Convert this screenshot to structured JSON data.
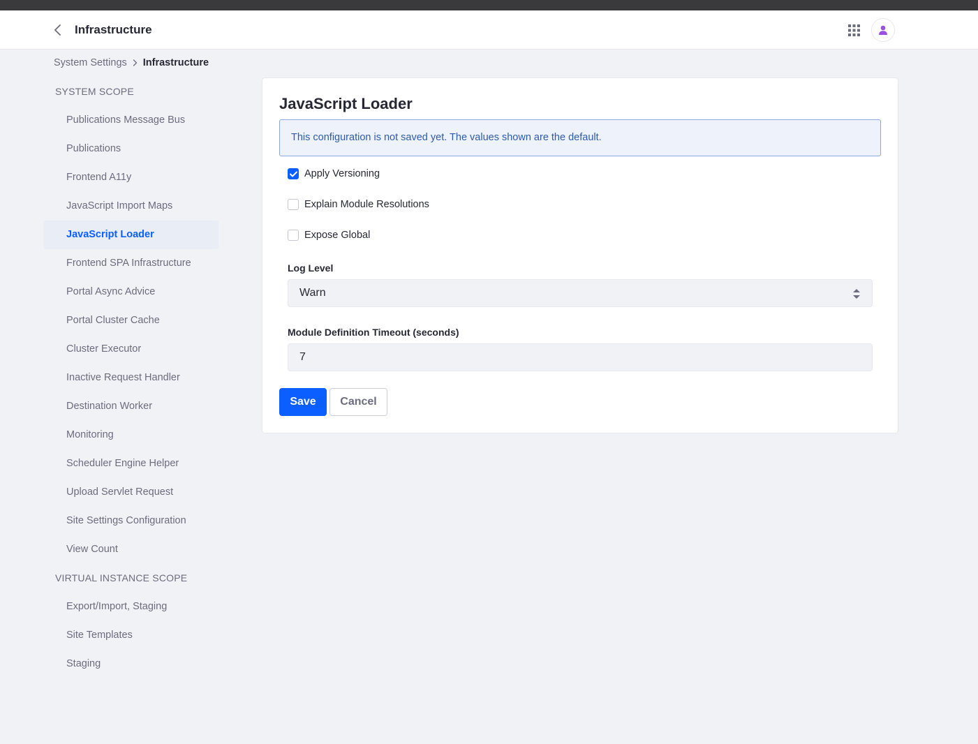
{
  "header": {
    "title": "Infrastructure",
    "back_icon": "chevron-left-icon",
    "apps_icon": "apps-grid-icon",
    "avatar_icon": "user-icon"
  },
  "breadcrumb": {
    "parent": "System Settings",
    "current": "Infrastructure"
  },
  "sidebar": {
    "system_scope_heading": "SYSTEM SCOPE",
    "system_items": [
      {
        "label": "Publications Message Bus"
      },
      {
        "label": "Publications"
      },
      {
        "label": "Frontend A11y"
      },
      {
        "label": "JavaScript Import Maps"
      },
      {
        "label": "JavaScript Loader",
        "active": true
      },
      {
        "label": "Frontend SPA Infrastructure"
      },
      {
        "label": "Portal Async Advice"
      },
      {
        "label": "Portal Cluster Cache"
      },
      {
        "label": "Cluster Executor"
      },
      {
        "label": "Inactive Request Handler"
      },
      {
        "label": "Destination Worker"
      },
      {
        "label": "Monitoring"
      },
      {
        "label": "Scheduler Engine Helper"
      },
      {
        "label": "Upload Servlet Request"
      },
      {
        "label": "Site Settings Configuration"
      },
      {
        "label": "View Count"
      }
    ],
    "virtual_scope_heading": "VIRTUAL INSTANCE SCOPE",
    "virtual_items": [
      {
        "label": "Export/Import, Staging"
      },
      {
        "label": "Site Templates"
      },
      {
        "label": "Staging"
      }
    ]
  },
  "form": {
    "title": "JavaScript Loader",
    "alert": "This configuration is not saved yet. The values shown are the default.",
    "checkboxes": [
      {
        "label": "Apply Versioning",
        "checked": true
      },
      {
        "label": "Explain Module Resolutions",
        "checked": false
      },
      {
        "label": "Expose Global",
        "checked": false
      }
    ],
    "log_level_label": "Log Level",
    "log_level_value": "Warn",
    "timeout_label": "Module Definition Timeout (seconds)",
    "timeout_value": "7",
    "save_label": "Save",
    "cancel_label": "Cancel"
  },
  "colors": {
    "primary": "#0b5fff",
    "alert_bg": "#eef2fa",
    "alert_text": "#2e5aac",
    "avatar_accent": "#9b51e0"
  }
}
